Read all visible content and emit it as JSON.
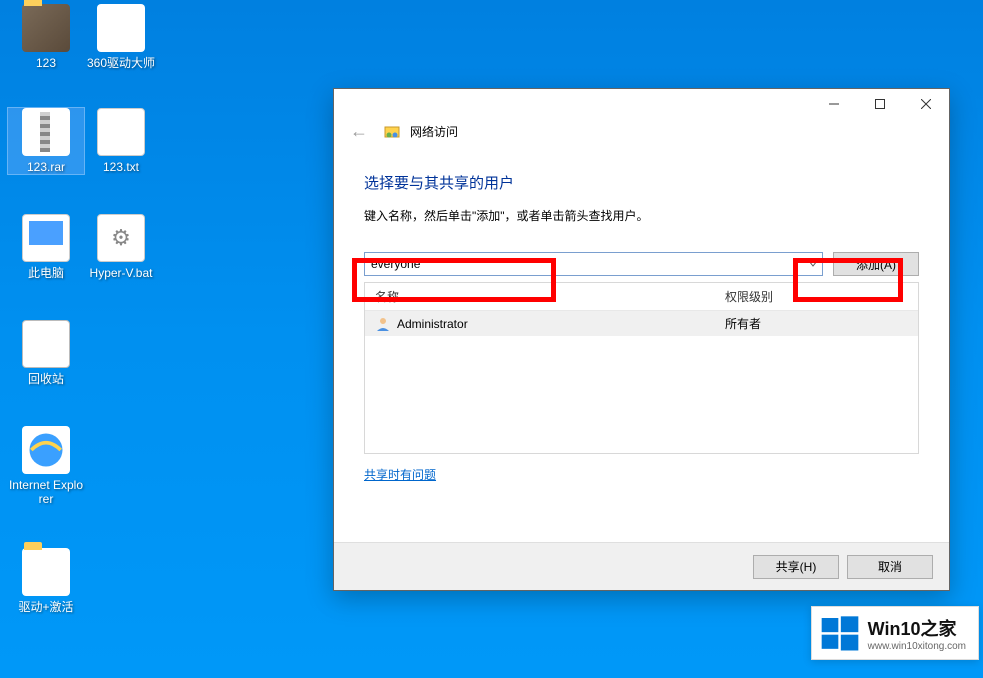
{
  "desktop": {
    "icons": [
      {
        "label": "123",
        "kind": "folder"
      },
      {
        "label": "360驱动大师",
        "kind": "gear"
      },
      {
        "label": "123.rar",
        "kind": "rar",
        "selected": true
      },
      {
        "label": "123.txt",
        "kind": "txt"
      },
      {
        "label": "此电脑",
        "kind": "pc"
      },
      {
        "label": "Hyper-V.bat",
        "kind": "bat"
      },
      {
        "label": "回收站",
        "kind": "bin"
      },
      {
        "label": "Internet Explorer",
        "kind": "ie"
      },
      {
        "label": "驱动+激活",
        "kind": "folder"
      }
    ]
  },
  "dialog": {
    "title": "网络访问",
    "section_title": "选择要与其共享的用户",
    "instruction": "键入名称，然后单击\"添加\"，或者单击箭头查找用户。",
    "input_value": "everyone",
    "add_button": "添加(A)",
    "columns": {
      "name": "名称",
      "perm": "权限级别"
    },
    "rows": [
      {
        "name": "Administrator",
        "perm": "所有者"
      }
    ],
    "help_link": "共享时有问题",
    "share_button": "共享(H)",
    "cancel_button": "取消"
  },
  "watermark": {
    "title": "Win10之家",
    "url": "www.win10xitong.com"
  }
}
